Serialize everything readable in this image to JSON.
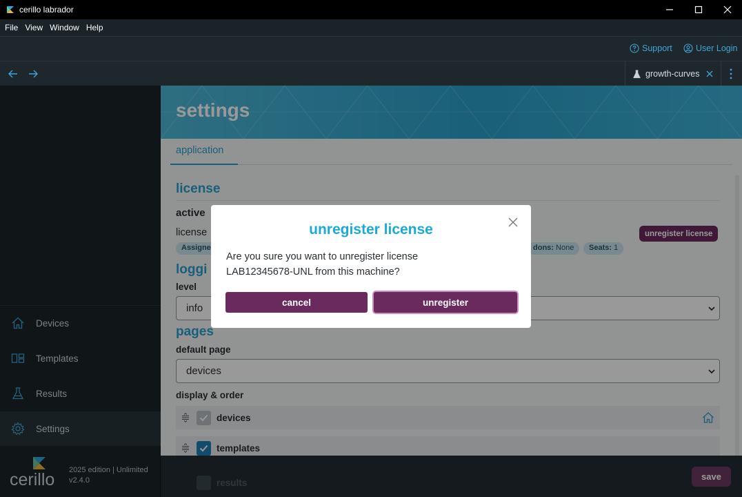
{
  "window": {
    "title": "cerillo labrador"
  },
  "menu": [
    "File",
    "View",
    "Window",
    "Help"
  ],
  "top_links": {
    "support": "Support",
    "user_login": "User Login"
  },
  "open_tab": {
    "label": "growth-curves"
  },
  "sidebar": {
    "items": [
      {
        "label": "Devices",
        "icon": "home-icon"
      },
      {
        "label": "Templates",
        "icon": "templates-icon"
      },
      {
        "label": "Results",
        "icon": "flask-icon"
      },
      {
        "label": "Settings",
        "icon": "gear-icon",
        "active": true
      }
    ],
    "brand": {
      "name": "cerillo",
      "edition": "2025 edition | Unlimited",
      "version": "v2.4.0"
    }
  },
  "page": {
    "title": "settings",
    "tabs": [
      "application"
    ],
    "license": {
      "heading": "license",
      "status": "active",
      "row_label": "license",
      "chips": {
        "assigned": "Assigne",
        "addons_label": "dons:",
        "addons_value": "None",
        "seats_label": "Seats:",
        "seats_value": "1"
      },
      "unregister_badge": "unregister license"
    },
    "logging": {
      "heading": "loggi",
      "level_label": "level",
      "level_value": "info"
    },
    "pages": {
      "heading": "pages",
      "default_page_label": "default page",
      "default_page_value": "devices",
      "display_order_label": "display & order",
      "rows": [
        {
          "name": "devices",
          "checked": true,
          "locked": true
        },
        {
          "name": "templates",
          "checked": true,
          "locked": false
        },
        {
          "name": "results",
          "checked": true,
          "locked": false
        }
      ]
    },
    "save_label": "save"
  },
  "modal": {
    "title": "unregister license",
    "message_line1": "Are you sure you want to unregister license",
    "message_line2": "LAB12345678-UNL from this machine?",
    "cancel_label": "cancel",
    "confirm_label": "unregister"
  },
  "colors": {
    "accent": "#2b9fcf",
    "brand_purple": "#6b2a5e",
    "title_cyan": "#1aaad8"
  }
}
